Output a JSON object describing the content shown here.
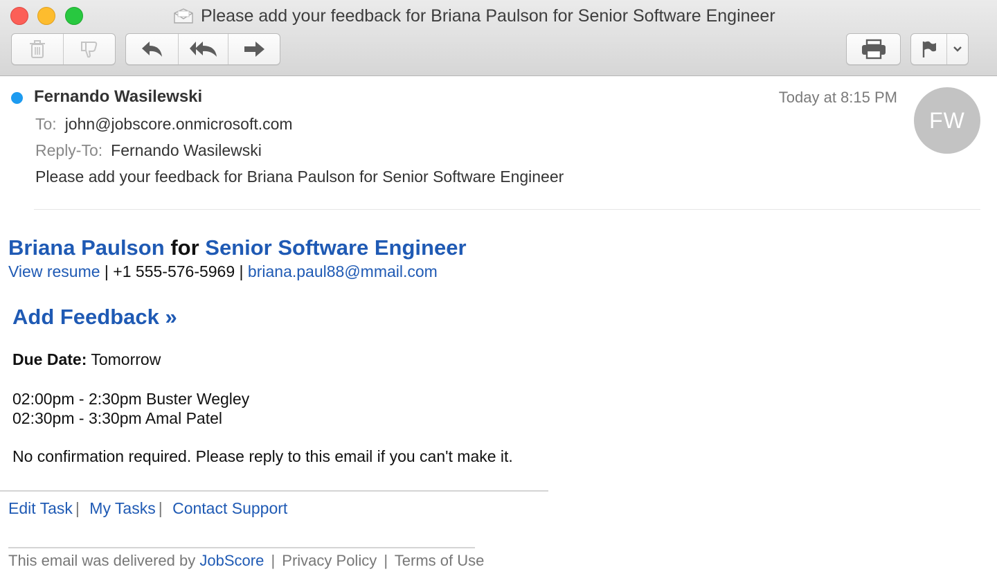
{
  "window": {
    "title": "Please add your feedback for Briana Paulson for Senior Software Engineer"
  },
  "toolbar": {
    "icons": [
      "trash-icon",
      "junk-icon",
      "reply-icon",
      "reply-all-icon",
      "forward-icon",
      "print-icon",
      "flag-icon",
      "chevron-down-icon"
    ]
  },
  "message": {
    "sender": "Fernando Wasilewski",
    "date": "Today at 8:15 PM",
    "avatar_initials": "FW",
    "to_label": "To:",
    "to": "john@jobscore.onmicrosoft.com",
    "reply_to_label": "Reply-To:",
    "reply_to": "Fernando Wasilewski",
    "subject": "Please add your feedback for Briana Paulson for Senior Software Engineer"
  },
  "body": {
    "candidate_name": "Briana Paulson",
    "for_word": "for",
    "position": "Senior Software Engineer",
    "view_resume": "View resume",
    "separator": "|",
    "phone": "+1 555-576-5969",
    "email": "briana.paul88@mmail.com",
    "add_feedback": "Add Feedback »",
    "due_label": "Due Date:",
    "due_value": "Tomorrow",
    "schedule": [
      "02:00pm - 2:30pm Buster Wegley",
      "02:30pm - 3:30pm Amal Patel"
    ],
    "note": "No confirmation required. Please reply to this email if you can't make it."
  },
  "footer": {
    "edit_task": "Edit Task",
    "my_tasks": "My Tasks",
    "contact_support": "Contact Support",
    "separator": "|",
    "delivered_prefix": "This email was delivered by",
    "jobscore": "JobScore",
    "privacy_policy": "Privacy Policy",
    "terms": "Terms of Use"
  },
  "colors": {
    "link": "#1f5ab4",
    "unread_dot": "#1d9bf0",
    "avatar_bg": "#c3c3c3"
  }
}
